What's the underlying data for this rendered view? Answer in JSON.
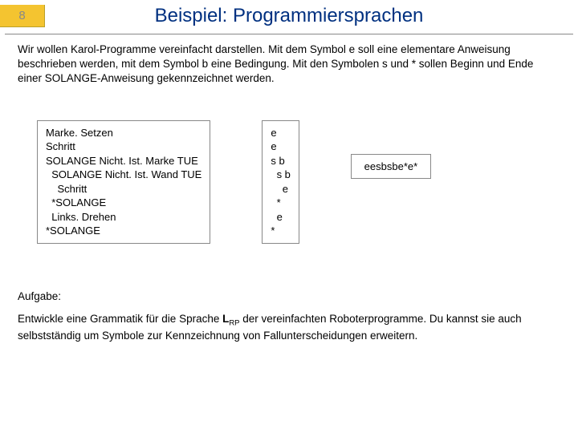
{
  "page_number": "8",
  "title": "Beispiel: Programmiersprachen",
  "intro": "Wir wollen Karol-Programme vereinfacht darstellen. Mit dem Symbol e soll eine elementare Anweisung beschrieben werden, mit dem Symbol b eine Bedingung. Mit den Symbolen s und * sollen Beginn und Ende einer SOLANGE-Anweisung gekennzeichnet werden.",
  "box1": "Marke. Setzen\nSchritt\nSOLANGE Nicht. Ist. Marke TUE\n  SOLANGE Nicht. Ist. Wand TUE\n    Schritt\n  *SOLANGE\n  Links. Drehen\n*SOLANGE",
  "box2": "e\ne\ns b\n  s b\n    e\n  *\n  e\n*",
  "box3": "eesbsbe*e*",
  "task_label": "Aufgabe:",
  "task_body_pre": "Entwickle eine Grammatik für die Sprache ",
  "task_body_lang": "L",
  "task_body_sub": "RP",
  "task_body_post": " der vereinfachten Roboterprogramme. Du kannst sie auch selbstständig um Symbole zur Kennzeichnung von Fallunterscheidungen erweitern."
}
